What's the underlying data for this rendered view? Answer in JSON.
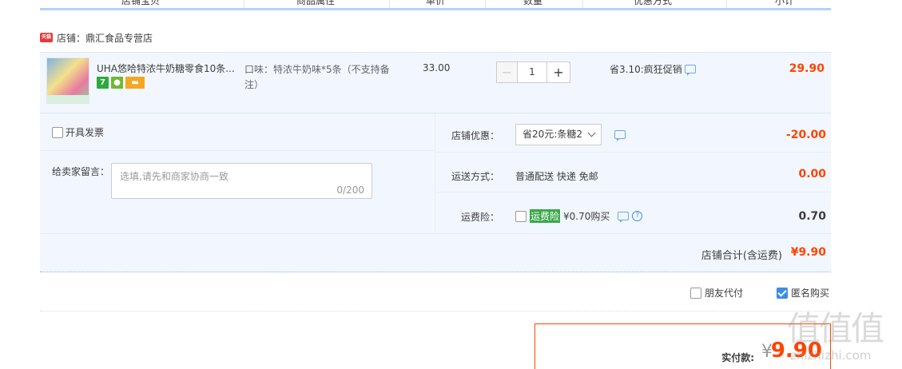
{
  "header": {
    "columns": [
      "店铺宝贝",
      "商品属性",
      "单价",
      "数量",
      "优惠方式",
      "小计"
    ]
  },
  "shop": {
    "badge_text": "天猫",
    "name": "店铺：鼎汇食品专营店"
  },
  "item": {
    "title": "UHA悠哈特浓牛奶糖零食10条...",
    "attribute": "口味：特浓牛奶味*5条（不支持备注）",
    "unit_price": "33.00",
    "quantity": "1",
    "minus_label": "−",
    "plus_label": "+",
    "promotion": "省3.10:疯狂促销",
    "subtotal": "29.90",
    "badge_7": "7"
  },
  "options": {
    "invoice_label": "开具发票",
    "message_label": "给卖家留言：",
    "message_placeholder": "选填,请先和商家协商一致",
    "message_count": "0/200",
    "shop_discount_label": "店铺优惠：",
    "shop_discount_value": "省20元:条糖2",
    "shop_discount_amount": "-20.00",
    "shipping_label": "运送方式：",
    "shipping_value": "普通配送 快递 免邮",
    "shipping_amount": "0.00",
    "insurance_label": "运费险：",
    "insurance_tag": "运费险",
    "insurance_value": "¥0.70购买",
    "insurance_amount": "0.70",
    "total_label": "店铺合计(含运费)",
    "total_value": "¥9.90"
  },
  "payment_options": {
    "friend_pay": "朋友代付",
    "anonymous": "匿名购买"
  },
  "pay": {
    "label": "实付款:",
    "currency": "¥",
    "value": "9.90"
  },
  "watermark": {
    "big": "值值值",
    "small": "zhizhizhi.com"
  },
  "colors": {
    "accent": "#ff4400",
    "header_border": "#b2d1ff",
    "row_bg": "#f2f7ff",
    "check_blue": "#3a8ee6",
    "green_tag": "#3aa84a"
  }
}
